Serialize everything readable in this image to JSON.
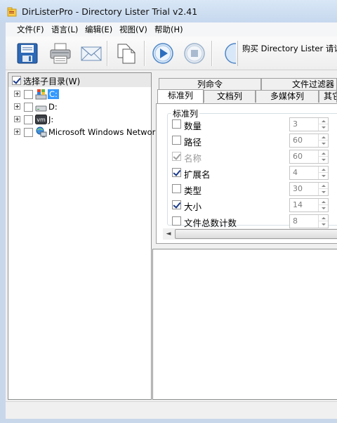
{
  "window": {
    "title": "DirListerPro - Directory Lister Trial v2.41"
  },
  "menu": [
    "文件(F)",
    "语言(L)",
    "编辑(E)",
    "视图(V)",
    "帮助(H)"
  ],
  "toolbar": {
    "buttons": [
      "save-icon",
      "print-icon",
      "email-icon",
      "copy-icon",
      "play-icon",
      "stop-icon"
    ],
    "promo_text": "购买 Directory Lister 请访问:"
  },
  "tree": {
    "include_subdirs": {
      "label": "选择子目录(W)",
      "checked": true
    },
    "items": [
      {
        "label": "C:",
        "selected": true
      },
      {
        "label": "D:"
      },
      {
        "label": "J:"
      },
      {
        "label": "Microsoft Windows Network"
      }
    ]
  },
  "tabs": {
    "top_row": [
      "列命令",
      "文件过滤器"
    ],
    "bottom_row": [
      "标准列",
      "文档列",
      "多媒体列",
      "其它"
    ],
    "active": "标准列"
  },
  "standard_columns": {
    "group_title": "标准列",
    "fields": [
      {
        "label": "数量",
        "checked": false,
        "value": "3",
        "disabled": false
      },
      {
        "label": "路径",
        "checked": false,
        "value": "60",
        "disabled": false
      },
      {
        "label": "名称",
        "checked": true,
        "value": "60",
        "disabled": true
      },
      {
        "label": "扩展名",
        "checked": true,
        "value": "4",
        "disabled": false
      },
      {
        "label": "类型",
        "checked": false,
        "value": "30",
        "disabled": false
      },
      {
        "label": "大小",
        "checked": true,
        "value": "14",
        "disabled": false
      },
      {
        "label": "文件总数计数",
        "checked": false,
        "value": "8",
        "disabled": false
      }
    ]
  },
  "colors": {
    "selection": "#3399ff",
    "titlebar": "#d9e7f6"
  }
}
